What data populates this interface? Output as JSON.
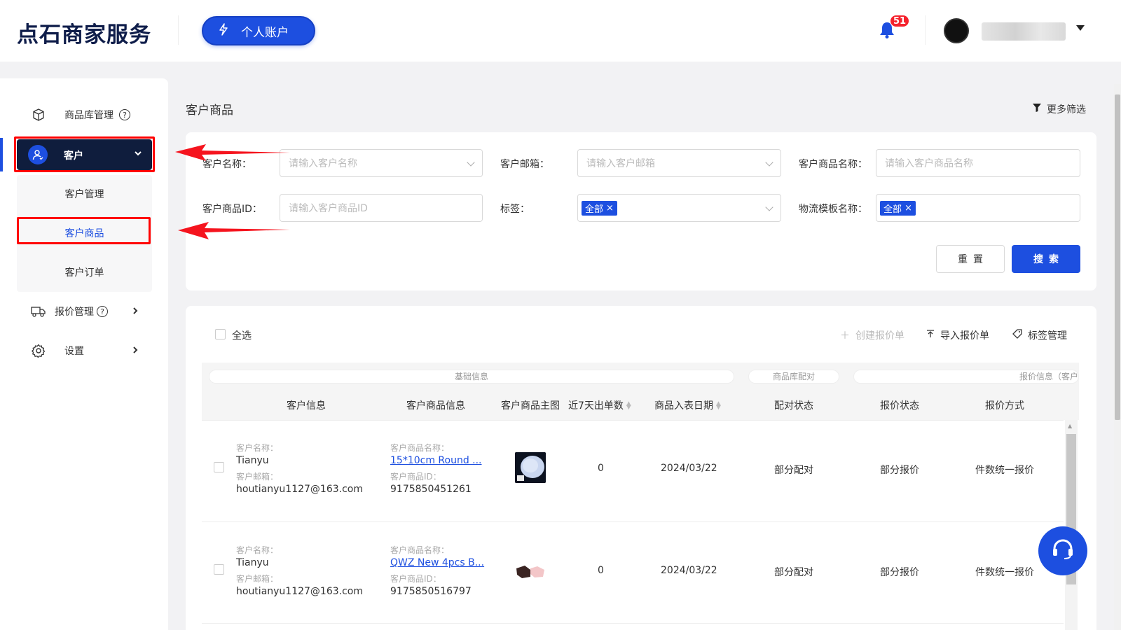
{
  "header": {
    "logo": "点石商家服务",
    "account_button": "个人账户",
    "notification_count": "51"
  },
  "sidebar": {
    "items": [
      {
        "label": "商品库管理",
        "icon": "box-icon"
      },
      {
        "label": "客户",
        "icon": "user-icon"
      },
      {
        "label": "报价管理",
        "icon": "truck-icon"
      },
      {
        "label": "设置",
        "icon": "gear-icon"
      }
    ],
    "submenu": [
      "客户管理",
      "客户商品",
      "客户订单"
    ]
  },
  "page": {
    "title": "客户商品",
    "more_filter": "更多筛选"
  },
  "filters": {
    "customer_name": {
      "label": "客户名称：",
      "placeholder": "请输入客户名称"
    },
    "customer_email": {
      "label": "客户邮箱：",
      "placeholder": "请输入客户邮箱"
    },
    "product_name": {
      "label": "客户商品名称：",
      "placeholder": "请输入客户商品名称"
    },
    "product_id": {
      "label": "客户商品ID：",
      "placeholder": "请输入客户商品ID"
    },
    "tag": {
      "label": "标签：",
      "chip": "全部"
    },
    "logistics": {
      "label": "物流模板名称：",
      "chip": "全部"
    },
    "reset": "重置",
    "search": "搜索"
  },
  "table": {
    "select_all": "全选",
    "toolbar": {
      "create_quote": "创建报价单",
      "import_quote": "导入报价单",
      "tag_manage": "标签管理"
    },
    "groups": {
      "basic": "基础信息",
      "match": "商品库配对",
      "quote": "报价信息（客户"
    },
    "columns": [
      "客户信息",
      "客户商品信息",
      "客户商品主图",
      "近7天出单数",
      "商品入表日期",
      "配对状态",
      "报价状态",
      "报价方式"
    ],
    "field_labels": {
      "customer_name": "客户名称：",
      "customer_email": "客户邮箱：",
      "product_name": "客户商品名称：",
      "product_id": "客户商品ID："
    },
    "rows": [
      {
        "customer_name": "Tianyu",
        "customer_email": "houtianyu1127@163.com",
        "product_name": "15*10cm Round ...",
        "product_id": "9175850451261",
        "orders_7d": "0",
        "date": "2024/03/22",
        "match_status": "部分配对",
        "quote_status": "部分报价",
        "quote_method": "件数统一报价"
      },
      {
        "customer_name": "Tianyu",
        "customer_email": "houtianyu1127@163.com",
        "product_name": "QWZ New 4pcs B...",
        "product_id": "9175850516797",
        "orders_7d": "0",
        "date": "2024/03/22",
        "match_status": "部分配对",
        "quote_status": "部分报价",
        "quote_method": "件数统一报价"
      }
    ]
  },
  "colors": {
    "primary": "#1d4fe0",
    "sidebar_active": "#0f1d3d",
    "highlight": "#ff0000"
  }
}
